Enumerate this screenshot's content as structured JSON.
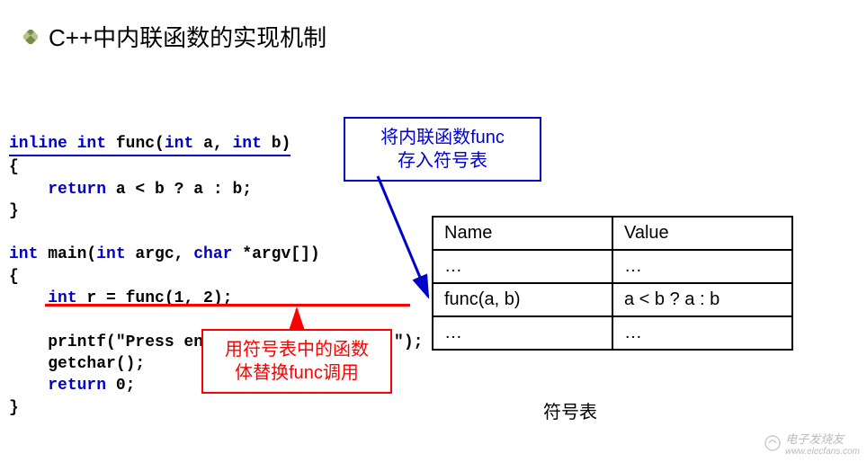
{
  "title": "C++中内联函数的实现机制",
  "code": {
    "l1_kw1": "inline",
    "l1_kw2": "int",
    "l1_name": "func(",
    "l1_kw3": "int",
    "l1_a": " a, ",
    "l1_kw4": "int",
    "l1_b": " b)",
    "l2": "{",
    "l3_pre": "    ",
    "l3_kw": "return",
    "l3_rest": " a < b ? a : b;",
    "l4": "}",
    "l6_kw1": "int",
    "l6_main": " main(",
    "l6_kw2": "int",
    "l6_argc": " argc, ",
    "l6_kw3": "char",
    "l6_argv": " *argv[])",
    "l7": "{",
    "l8_pre": "    ",
    "l8_kw": "int",
    "l8_rest": " r = func(1, 2);",
    "l10_pre": "    printf(\"Press en",
    "l10_post": "\");",
    "l11": "    getchar();",
    "l12_pre": "    ",
    "l12_kw": "return",
    "l12_rest": " 0;",
    "l13": "}"
  },
  "callouts": {
    "c1_line1": "将内联函数func",
    "c1_line2": "存入符号表",
    "c2_line1": "用符号表中的函数",
    "c2_line2": "体替换func调用"
  },
  "table": {
    "h_name": "Name",
    "h_value": "Value",
    "r1_name": "…",
    "r1_value": "…",
    "r2_name": "func(a, b)",
    "r2_value": "a < b ? a : b",
    "r3_name": "…",
    "r3_value": "…",
    "caption": "符号表"
  },
  "watermark": {
    "brand": "电子发烧友",
    "url": "www.elecfans.com"
  }
}
